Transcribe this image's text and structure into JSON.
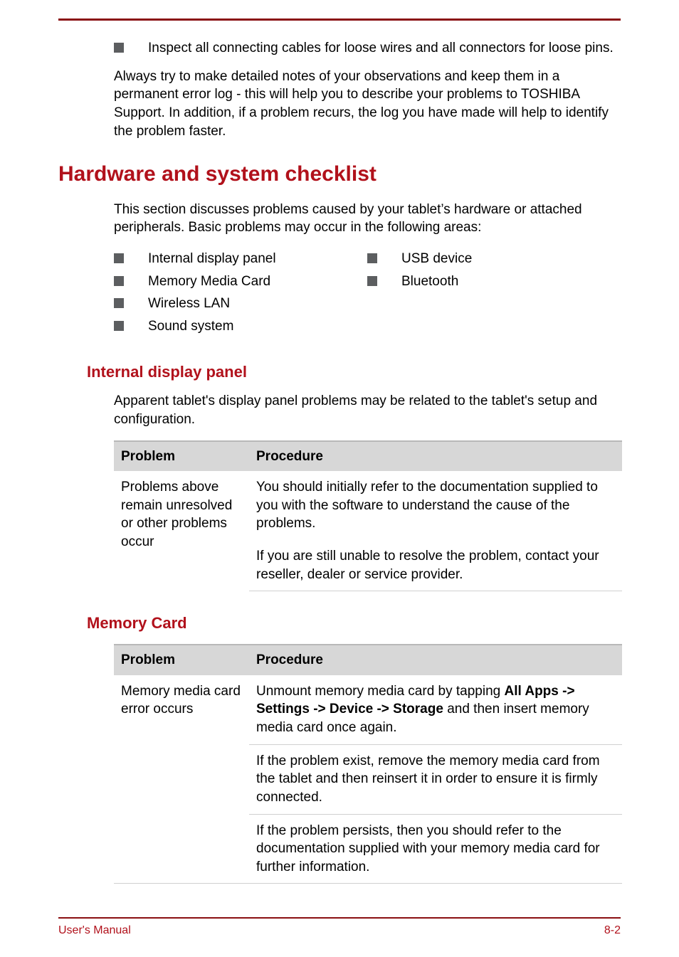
{
  "intro": {
    "bullet": "Inspect all connecting cables for loose wires and all connectors for loose pins.",
    "para": "Always try to make detailed notes of your observations and keep them in a permanent error log - this will help you to describe your problems to TOSHIBA Support. In addition, if a problem recurs, the log you have made will help to identify the problem faster."
  },
  "section": {
    "title": "Hardware and system checklist",
    "para": "This section discusses problems caused by your tablet’s hardware or attached peripherals. Basic problems may occur in the following areas:",
    "left_items": [
      "Internal display panel",
      "Memory Media Card",
      "Wireless LAN",
      "Sound system"
    ],
    "right_items": [
      "USB device",
      "Bluetooth"
    ]
  },
  "sub1": {
    "title": "Internal display panel",
    "para": "Apparent tablet's display panel problems may be related to the tablet's setup and configuration.",
    "headers": {
      "col1": "Problem",
      "col2": "Procedure"
    },
    "row_problem": "Problems above remain unresolved or other problems occur",
    "row_proc1": "You should initially refer to the documentation supplied to you with the software to understand the cause of the problems.",
    "row_proc2": "If you are still unable to resolve the problem, contact your reseller, dealer or service provider."
  },
  "sub2": {
    "title": "Memory Card",
    "headers": {
      "col1": "Problem",
      "col2": "Procedure"
    },
    "row_problem": "Memory media card error occurs",
    "proc1_pre": "Unmount memory media card by tapping ",
    "proc1_bold": "All Apps -> Settings -> Device -> Storage",
    "proc1_post": " and then insert memory media card once again.",
    "proc2": "If the problem exist, remove the memory media card from the tablet and then reinsert it in order to ensure it is firmly connected.",
    "proc3": "If the problem persists, then you should refer to the documentation supplied with your memory media card for further information."
  },
  "footer": {
    "left": "User's Manual",
    "right": "8-2"
  },
  "colors": {
    "accent": "#b1111b"
  }
}
